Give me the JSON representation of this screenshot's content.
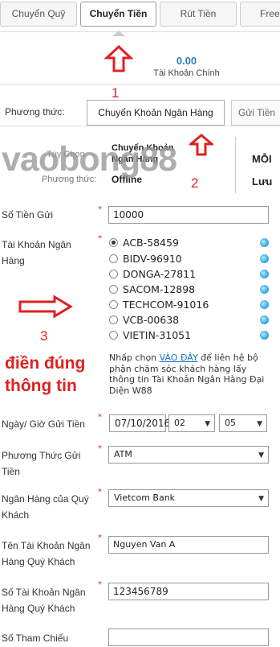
{
  "top_tabs": [
    {
      "label": "Chuyển Quỹ"
    },
    {
      "label": "Chuyển Tiền"
    },
    {
      "label": "Rút Tiền"
    },
    {
      "label": "Free"
    }
  ],
  "balance": {
    "amount": "0.00",
    "label": "Tài Khoản Chính"
  },
  "method": {
    "label": "Phương thức:",
    "tabs": [
      {
        "label": "Chuyển Khoản Ngân Hàng"
      },
      {
        "label": "Gửi Tiền"
      }
    ]
  },
  "info": {
    "type_label": "Tùy Chọn",
    "type_value_line1": "Chuyển Khoản",
    "type_value_line2": "Ngân Hàng",
    "method_label": "Phương thức:",
    "method_value": "Offline",
    "right_top": "MỖI",
    "right_bottom": "Lưu"
  },
  "watermark": "vaobong88",
  "annotations": {
    "step1": "1",
    "step2": "2",
    "step3": "3",
    "fill_line1": "điền đúng",
    "fill_line2": "thông tin"
  },
  "form": {
    "amount": {
      "label": "Số Tiền Gửi",
      "value": "10000"
    },
    "bank_account": {
      "label_line1": "Tài Khoản Ngân",
      "label_line2": "Hàng",
      "options": [
        {
          "label": "ACB-58459",
          "selected": true
        },
        {
          "label": "BIDV-96910",
          "selected": false
        },
        {
          "label": "DONGA-27811",
          "selected": false
        },
        {
          "label": "SACOM-12898",
          "selected": false
        },
        {
          "label": "TECHCOM-91016",
          "selected": false
        },
        {
          "label": "VCB-00638",
          "selected": false
        },
        {
          "label": "VIETIN-31051",
          "selected": false
        }
      ]
    },
    "help": {
      "prefix": "Nhấp chọn ",
      "link": "VÀO ĐÂY",
      "suffix": " để liên hệ bộ phận chăm sóc khách hàng lấy thông tin Tài Khoản Ngân Hàng Đại Diện W88"
    },
    "date": {
      "label": "Ngày/ Giờ Gửi Tiền",
      "date_value": "07/10/2016",
      "hour": "02",
      "minute": "05"
    },
    "deposit_method": {
      "label_line1": "Phương Thức Gửi",
      "label_line2": "Tiền",
      "value": "ATM"
    },
    "customer_bank": {
      "label_line1": "Ngân Hàng của Quý",
      "label_line2": "Khách",
      "value": "Vietcom Bank"
    },
    "account_name": {
      "label_line1": "Tên Tài Khoản Ngân",
      "label_line2": "Hàng Quý Khách",
      "value": "Nguyen Van A"
    },
    "account_number": {
      "label_line1": "Số Tài Khoản Ngân",
      "label_line2": "Hàng Quý Khách",
      "value": "123456789"
    },
    "reference": {
      "label": "Số Tham Chiếu",
      "value": ""
    }
  },
  "colors": {
    "annotation_red": "#e02020",
    "balance_blue": "#2b7fbf",
    "status_dot": "#34a8e6"
  }
}
